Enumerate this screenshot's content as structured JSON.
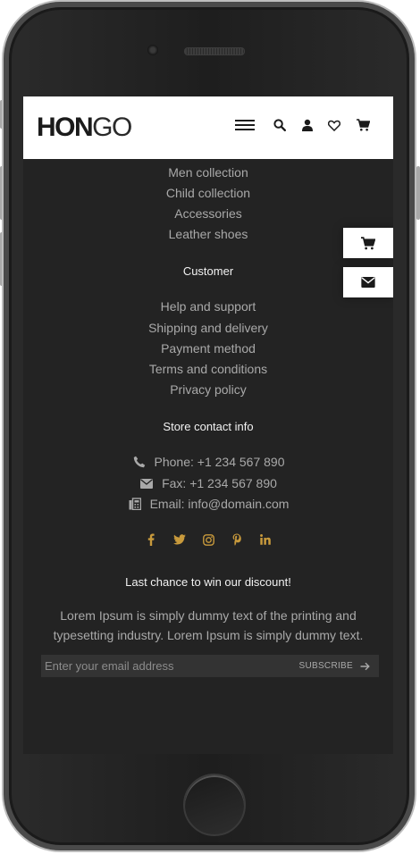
{
  "header": {
    "logo_bold": "HON",
    "logo_light": "GO"
  },
  "shop_links": [
    "Men collection",
    "Child collection",
    "Accessories",
    "Leather shoes"
  ],
  "customer": {
    "heading": "Customer",
    "links": [
      "Help and support",
      "Shipping and delivery",
      "Payment method",
      "Terms and conditions",
      "Privacy policy"
    ]
  },
  "contact": {
    "heading": "Store contact info",
    "phone": "Phone: +1 234 567 890",
    "fax": "Fax: +1 234 567 890",
    "email": "Email: info@domain.com"
  },
  "social_icons": [
    "facebook-icon",
    "twitter-icon",
    "instagram-icon",
    "pinterest-icon",
    "linkedin-icon"
  ],
  "newsletter": {
    "heading": "Last chance to win our discount!",
    "description": "Lorem Ipsum is simply dummy text of the printing and typesetting industry. Lorem Ipsum is simply dummy text.",
    "placeholder": "Enter your email address",
    "button_label": "SUBSCRIBE"
  },
  "floating": [
    "cart-icon",
    "mail-icon"
  ],
  "colors": {
    "footer_bg": "#232323",
    "accent": "#c89a3c",
    "link": "#a9a9a9"
  }
}
